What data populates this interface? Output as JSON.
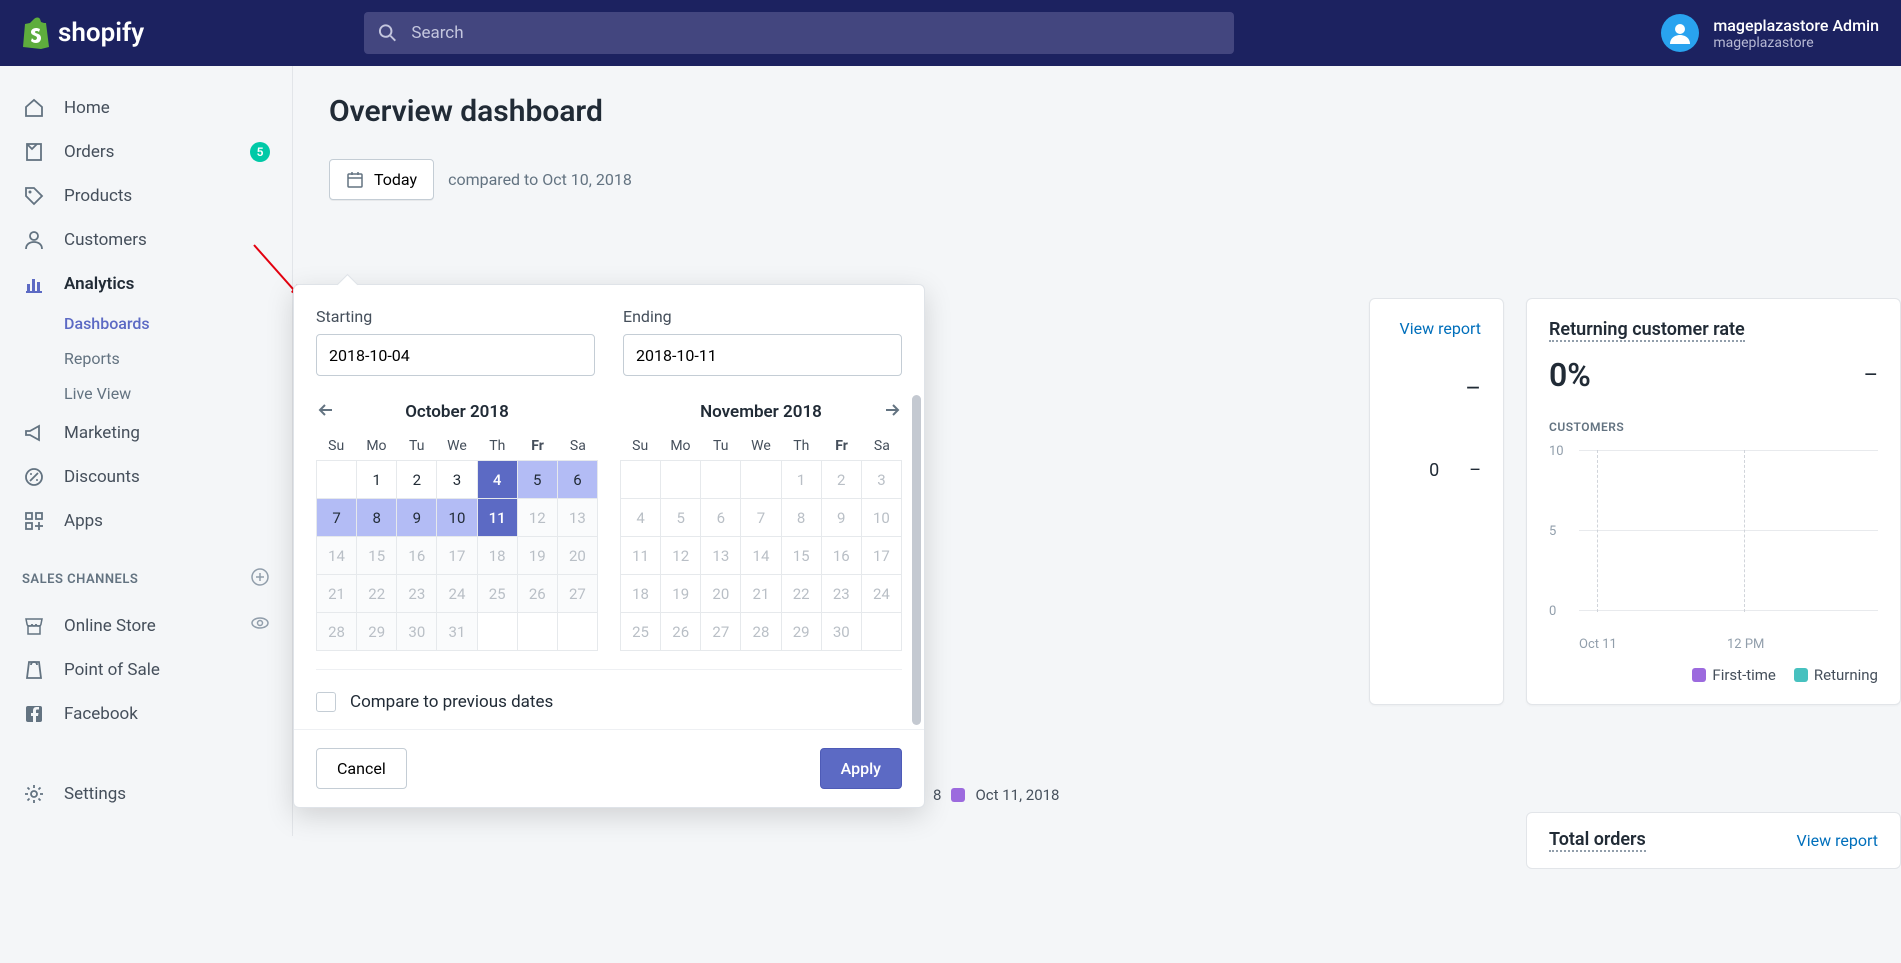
{
  "header": {
    "brand": "shopify",
    "search_placeholder": "Search",
    "user_name": "mageplazastore Admin",
    "user_store": "mageplazastore"
  },
  "sidebar": {
    "items": [
      {
        "label": "Home"
      },
      {
        "label": "Orders",
        "badge": "5"
      },
      {
        "label": "Products"
      },
      {
        "label": "Customers"
      },
      {
        "label": "Analytics",
        "active": true,
        "sub": [
          {
            "label": "Dashboards",
            "active": true
          },
          {
            "label": "Reports"
          },
          {
            "label": "Live View"
          }
        ]
      },
      {
        "label": "Marketing"
      },
      {
        "label": "Discounts"
      },
      {
        "label": "Apps"
      }
    ],
    "channels_header": "SALES CHANNELS",
    "channels": [
      {
        "label": "Online Store",
        "eye": true
      },
      {
        "label": "Point of Sale"
      },
      {
        "label": "Facebook"
      }
    ],
    "settings": "Settings"
  },
  "page": {
    "title": "Overview dashboard",
    "today_button": "Today",
    "compared_text": "compared to Oct 10, 2018"
  },
  "datepicker": {
    "starting_label": "Starting",
    "starting_value": "2018-10-04",
    "ending_label": "Ending",
    "ending_value": "2018-10-11",
    "month1": "October 2018",
    "month2": "November 2018",
    "weekdays": [
      "Su",
      "Mo",
      "Tu",
      "We",
      "Th",
      "Fr",
      "Sa"
    ],
    "today_weekday": "Fr",
    "oct_blanks": 1,
    "oct_days": 31,
    "oct_range_start": 4,
    "oct_range_end": 11,
    "oct_selected": [
      4,
      11
    ],
    "oct_future_after": 11,
    "nov_blanks": 4,
    "nov_days": 30,
    "compare_label": "Compare to previous dates",
    "cancel": "Cancel",
    "apply": "Apply"
  },
  "card_partial": {
    "view_report": "View report",
    "dash": "–",
    "zero": "0"
  },
  "card_returning": {
    "title": "Returning customer rate",
    "value": "0%",
    "dash": "–",
    "customers_label": "CUSTOMERS"
  },
  "chart_data": {
    "type": "line",
    "series": [
      {
        "name": "First-time",
        "color": "#9c6ade",
        "values": []
      },
      {
        "name": "Returning",
        "color": "#47c1bf",
        "values": []
      }
    ],
    "y_ticks": [
      10,
      5,
      0
    ],
    "x_ticks": [
      "Oct 11",
      "12 PM"
    ],
    "ylim": [
      0,
      10
    ]
  },
  "legend_foot": {
    "date": "Oct 11, 2018",
    "num": "8",
    "color": "#9c6ade"
  },
  "total_orders": {
    "title": "Total orders",
    "view_report": "View report"
  }
}
